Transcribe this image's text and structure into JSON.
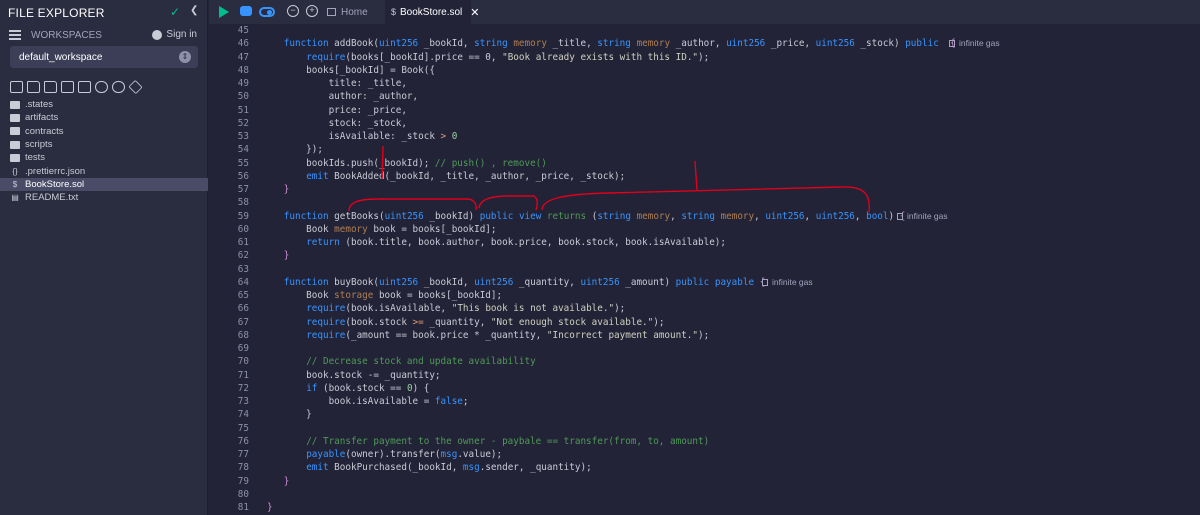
{
  "sidebar": {
    "title": "FILE EXPLORER",
    "workspaces_label": "WORKSPACES",
    "signin_label": "Sign in",
    "workspace_selected": "default_workspace",
    "tree": [
      {
        "name": ".states",
        "type": "folder"
      },
      {
        "name": "artifacts",
        "type": "folder"
      },
      {
        "name": "contracts",
        "type": "folder"
      },
      {
        "name": "scripts",
        "type": "folder"
      },
      {
        "name": "tests",
        "type": "folder"
      },
      {
        "name": ".prettierrc.json",
        "type": "json"
      },
      {
        "name": "BookStore.sol",
        "type": "sol",
        "selected": true
      },
      {
        "name": "README.txt",
        "type": "txt"
      }
    ]
  },
  "tabs": {
    "home": "Home",
    "active": "BookStore.sol"
  },
  "gas_label": "infinite gas",
  "colors": {
    "accent_green": "#00bf8c",
    "accent_blue": "#3794ff",
    "annotation_red": "#e0001b"
  },
  "code_lines": [
    {
      "n": "45",
      "html": ""
    },
    {
      "n": "46",
      "html": "   <span class='kw'>function</span> addBook(<span class='ty'>uint256</span> _bookId, <span class='ty'>string</span> <span class='mem'>memory</span> _title, <span class='ty'>string</span> <span class='mem'>memory</span> _author, <span class='ty'>uint256</span> _price, <span class='ty'>uint256</span> _stock) <span class='kw'>public</span>  <span class='brace'>{</span>",
      "gas": true
    },
    {
      "n": "47",
      "html": "       <span class='kw'>require</span>(books[_bookId].price == 0, <span class='str'>\"Book already exists with this ID.\"</span>);"
    },
    {
      "n": "48",
      "html": "       books[_bookId] = Book({"
    },
    {
      "n": "49",
      "html": "           title: _title,"
    },
    {
      "n": "50",
      "html": "           author: _author,"
    },
    {
      "n": "51",
      "html": "           price: _price,"
    },
    {
      "n": "52",
      "html": "           stock: _stock,"
    },
    {
      "n": "53",
      "html": "           isAvailable: _stock <span class='mod'>&gt;</span> <span class='num'>0</span>"
    },
    {
      "n": "54",
      "html": "       });"
    },
    {
      "n": "55",
      "html": "       bookIds.push(_bookId); <span class='cmt'>// push() , remove()</span>"
    },
    {
      "n": "56",
      "html": "       <span class='kw'>emit</span> BookAdded(_bookId, _title, _author, _price, _stock);"
    },
    {
      "n": "57",
      "html": "   <span class='brace'>}</span>"
    },
    {
      "n": "58",
      "html": ""
    },
    {
      "n": "59",
      "html": "   <span class='kw'>function</span> getBooks(<span class='ty'>uint256</span> _bookId) <span class='kw'>public</span> <span class='kw'>view</span> <span class='cmt'>returns</span> (<span class='ty'>string</span> <span class='mem'>memory</span>, <span class='ty'>string</span> <span class='mem'>memory</span>, <span class='ty'>uint256</span>, <span class='ty'>uint256</span>, <span class='ty'>bool</span>) <span class='brace'>{</span>",
      "gas": true
    },
    {
      "n": "60",
      "html": "       Book <span class='mem'>memory</span> book = books[_bookId];"
    },
    {
      "n": "61",
      "html": "       <span class='kw'>return</span> (book.title, book.author, book.price, book.stock, book.isAvailable);"
    },
    {
      "n": "62",
      "html": "   <span class='brace'>}</span>"
    },
    {
      "n": "63",
      "html": ""
    },
    {
      "n": "64",
      "html": "   <span class='kw'>function</span> buyBook(<span class='ty'>uint256</span> _bookId, <span class='ty'>uint256</span> _quantity, <span class='ty'>uint256</span> _amount) <span class='kw'>public</span> <span class='kw'>payable</span> <span class='brace'>{</span>",
      "gas": true
    },
    {
      "n": "65",
      "html": "       Book <span class='mem'>storage</span> book = books[_bookId];"
    },
    {
      "n": "66",
      "html": "       <span class='kw'>require</span>(book.isAvailable, <span class='str'>\"This book is not available.\"</span>);"
    },
    {
      "n": "67",
      "html": "       <span class='kw'>require</span>(book.stock <span class='mod'>&gt;=</span> _quantity, <span class='str'>\"Not enough stock available.\"</span>);"
    },
    {
      "n": "68",
      "html": "       <span class='kw'>require</span>(_amount == book.price * _quantity, <span class='str'>\"Incorrect payment amount.\"</span>);"
    },
    {
      "n": "69",
      "html": ""
    },
    {
      "n": "70",
      "html": "       <span class='cmt'>// Decrease stock and update availability</span>"
    },
    {
      "n": "71",
      "html": "       book.stock -= _quantity;"
    },
    {
      "n": "72",
      "html": "       <span class='kw'>if</span> (book.stock == <span class='num'>0</span>) {"
    },
    {
      "n": "73",
      "html": "           book.isAvailable = <span class='kw'>false</span>;"
    },
    {
      "n": "74",
      "html": "       }"
    },
    {
      "n": "75",
      "html": ""
    },
    {
      "n": "76",
      "html": "       <span class='cmt'>// Transfer payment to the owner - paybale == transfer(from, to, amount)</span>"
    },
    {
      "n": "77",
      "html": "       <span class='kw'>payable</span>(owner).transfer(<span class='kw'>msg</span>.value);"
    },
    {
      "n": "78",
      "html": "       <span class='kw'>emit</span> BookPurchased(_bookId, <span class='kw'>msg</span>.sender, _quantity);"
    },
    {
      "n": "79",
      "html": "   <span class='brace'>}</span>"
    },
    {
      "n": "80",
      "html": ""
    },
    {
      "n": "81",
      "html": "<span class='brace'>}</span>"
    }
  ]
}
